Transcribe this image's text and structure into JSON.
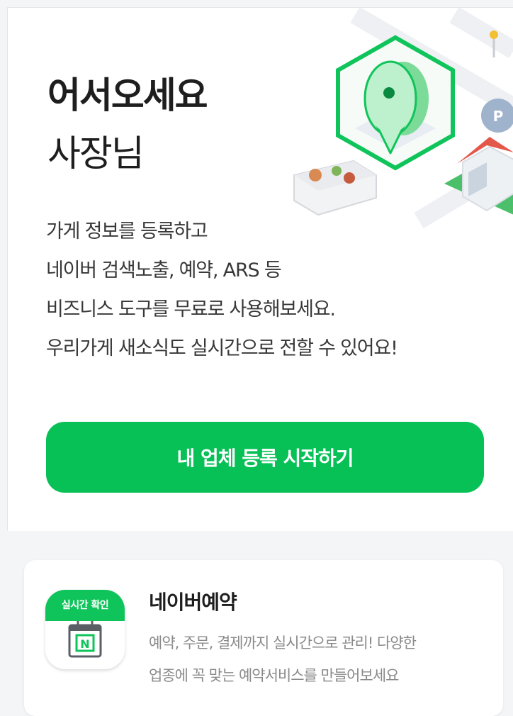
{
  "hero": {
    "title_strong": "어서오세요",
    "title_light": "사장님",
    "description_lines": [
      "가게 정보를 등록하고",
      "네이버 검색노출, 예약, ARS 등",
      "비즈니스 도구를 무료로 사용해보세요.",
      "우리가게 새소식도 실시간으로 전할 수 있어요!"
    ],
    "cta_label": "내 업체 등록 시작하기",
    "illustration_icon": "map-pin-hexagon-icon"
  },
  "service": {
    "icon": {
      "badge_label": "실시간 확인",
      "letter": "N",
      "name": "calendar-icon"
    },
    "name": "네이버예약",
    "description_lines": [
      "예약, 주문, 결제까지 실시간으로 관리! 다양한",
      "업종에 꼭 맞는 예약서비스를 만들어보세요"
    ]
  },
  "colors": {
    "brand_green": "#07c157",
    "page_background": "#f4f5f7",
    "card_background": "#ffffff"
  }
}
